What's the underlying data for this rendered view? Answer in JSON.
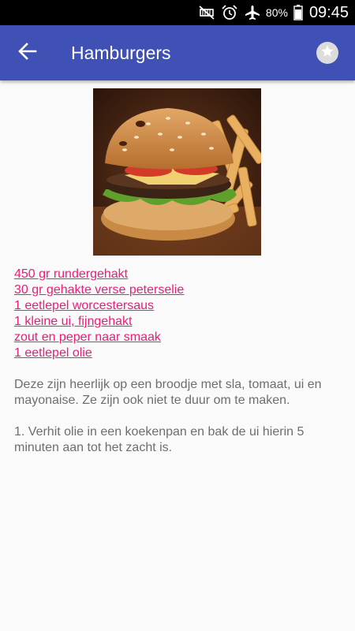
{
  "status_bar": {
    "icons": [
      "mute-icon",
      "alarm-icon",
      "airplane-mode-icon",
      "battery-icon"
    ],
    "battery": "80%",
    "time": "09:45"
  },
  "app_bar": {
    "title": "Hamburgers",
    "back_icon": "back-arrow-icon",
    "favorite_icon": "star-icon"
  },
  "recipe": {
    "image_subject": "hamburger with fries",
    "ingredients": [
      "450 gr rundergehakt",
      "30 gr gehakte verse peterselie",
      "1 eetlepel worcestersaus",
      "1 kleine ui, fijngehakt",
      "zout en peper naar smaak",
      "1 eetlepel olie"
    ],
    "description": "Deze zijn heerlijk op een broodje met sla, tomaat, ui en mayonaise. Ze zijn ook niet te duur om te maken.",
    "step_1": "1. Verhit olie in een koekenpan en bak de ui hierin 5 minuten aan tot het zacht is."
  },
  "colors": {
    "app_bar": "#3f51b5",
    "link": "#e91e78",
    "body_text": "#6e6e6e",
    "background": "#fafafa"
  }
}
